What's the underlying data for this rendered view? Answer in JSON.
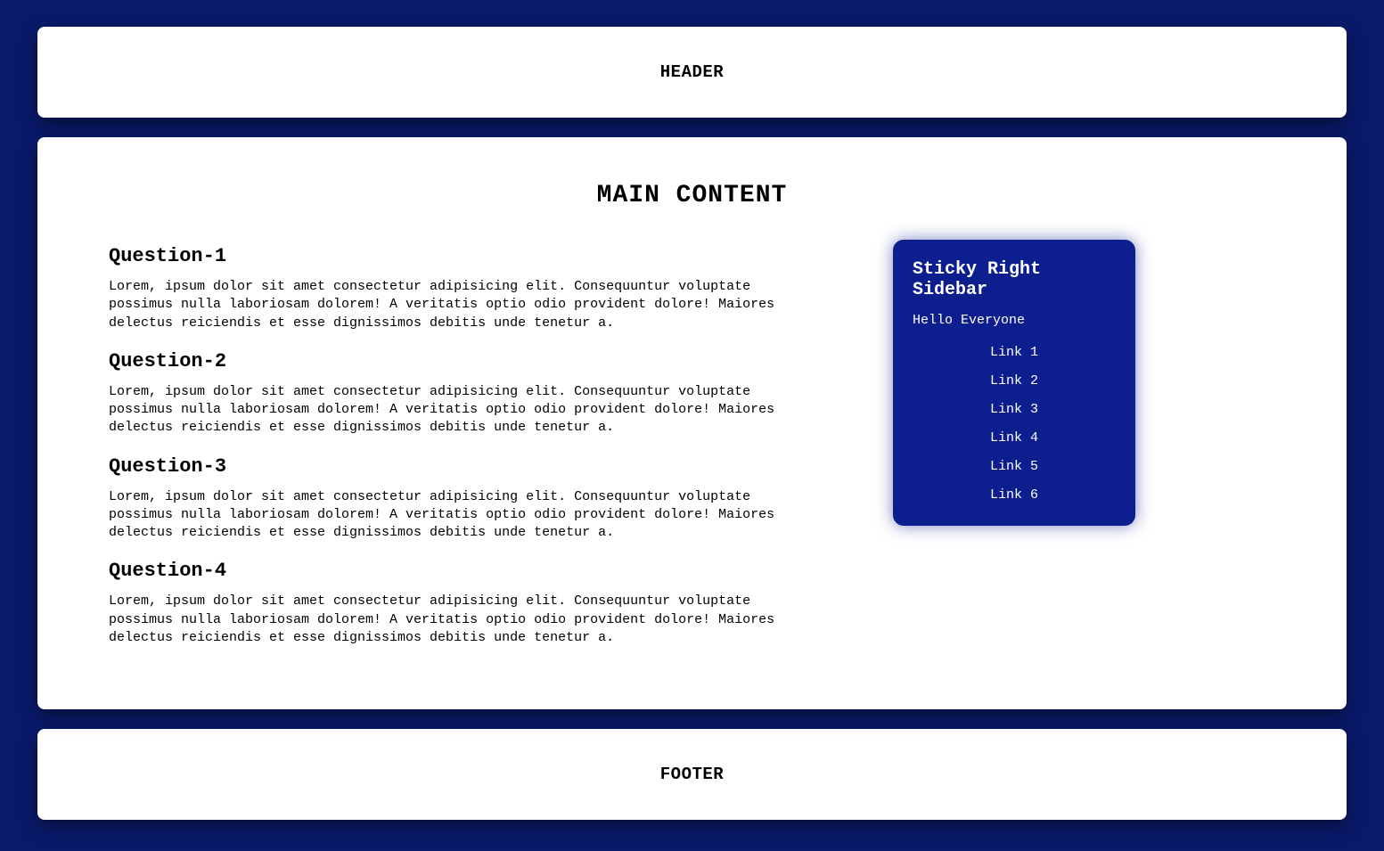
{
  "header": {
    "title": "HEADER"
  },
  "main": {
    "title": "MAIN CONTENT",
    "questions": [
      {
        "heading": "Question-1",
        "body": "Lorem, ipsum dolor sit amet consectetur adipisicing elit. Consequuntur voluptate possimus nulla laboriosam dolorem! A veritatis optio odio provident dolore! Maiores delectus reiciendis et esse dignissimos debitis unde tenetur a."
      },
      {
        "heading": "Question-2",
        "body": "Lorem, ipsum dolor sit amet consectetur adipisicing elit. Consequuntur voluptate possimus nulla laboriosam dolorem! A veritatis optio odio provident dolore! Maiores delectus reiciendis et esse dignissimos debitis unde tenetur a."
      },
      {
        "heading": "Question-3",
        "body": "Lorem, ipsum dolor sit amet consectetur adipisicing elit. Consequuntur voluptate possimus nulla laboriosam dolorem! A veritatis optio odio provident dolore! Maiores delectus reiciendis et esse dignissimos debitis unde tenetur a."
      },
      {
        "heading": "Question-4",
        "body": "Lorem, ipsum dolor sit amet consectetur adipisicing elit. Consequuntur voluptate possimus nulla laboriosam dolorem! A veritatis optio odio provident dolore! Maiores delectus reiciendis et esse dignissimos debitis unde tenetur a."
      }
    ],
    "sidebar": {
      "title": "Sticky Right Sidebar",
      "subtitle": "Hello Everyone",
      "links": [
        "Link 1",
        "Link 2",
        "Link 3",
        "Link 4",
        "Link 5",
        "Link 6"
      ]
    }
  },
  "footer": {
    "title": "FOOTER"
  }
}
